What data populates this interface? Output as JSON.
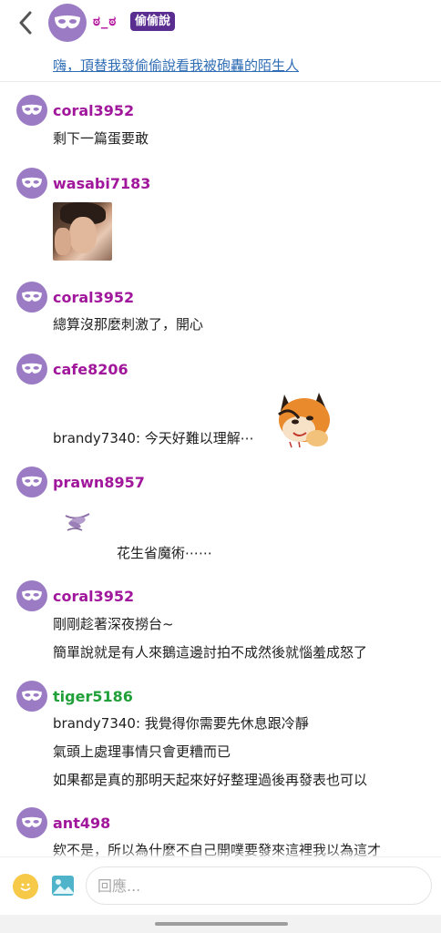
{
  "header": {
    "back_icon": "chevron-left-icon",
    "avatar_icon": "mask-icon",
    "name": "ಠ_ಠ",
    "badge": "偷偷說",
    "op_link": "嗨，頂替我發偷偷說看我被砲轟的陌生人"
  },
  "messages": [
    {
      "user": "coral3952",
      "lines": [
        "剩下一篇蛋要敢"
      ]
    },
    {
      "user": "wasabi7183",
      "image": "photo-of-person"
    },
    {
      "user": "coral3952",
      "lines": [
        "總算沒那麼刺激了，開心"
      ]
    },
    {
      "user": "cafe8206",
      "lines": [
        "brandy7340: 今天好難以理解⋯"
      ],
      "sticker": "fox-sticker"
    },
    {
      "user": "prawn8957",
      "sticker": "flower-sticker",
      "lines": [
        "花生省魔術⋯⋯"
      ]
    },
    {
      "user": "coral3952",
      "lines": [
        "剛剛趁著深夜撈台~",
        "簡單說就是有人來鵝這邊討拍不成然後就惱羞成怒了"
      ]
    },
    {
      "user": "tiger5186",
      "user_color": "#21a03a",
      "lines": [
        "brandy7340: 我覺得你需要先休息跟冷靜",
        "氣頭上處理事情只會更糟而已",
        "如果都是真的那明天起來好好整理過後再發表也可以"
      ]
    },
    {
      "user": "ant498",
      "lines": [
        "欸不是，所以為什麼不自己開噗要發來這裡我以為這才"
      ]
    }
  ],
  "footer": {
    "emoji_icon": "smiley-icon",
    "image_icon": "image-icon",
    "reply_placeholder": "回應..."
  },
  "colors": {
    "username": "#a1179c",
    "username_green": "#21a03a",
    "avatar": "#9b7bc4",
    "badge_bg": "#5a2d91",
    "link": "#2f6db5"
  }
}
